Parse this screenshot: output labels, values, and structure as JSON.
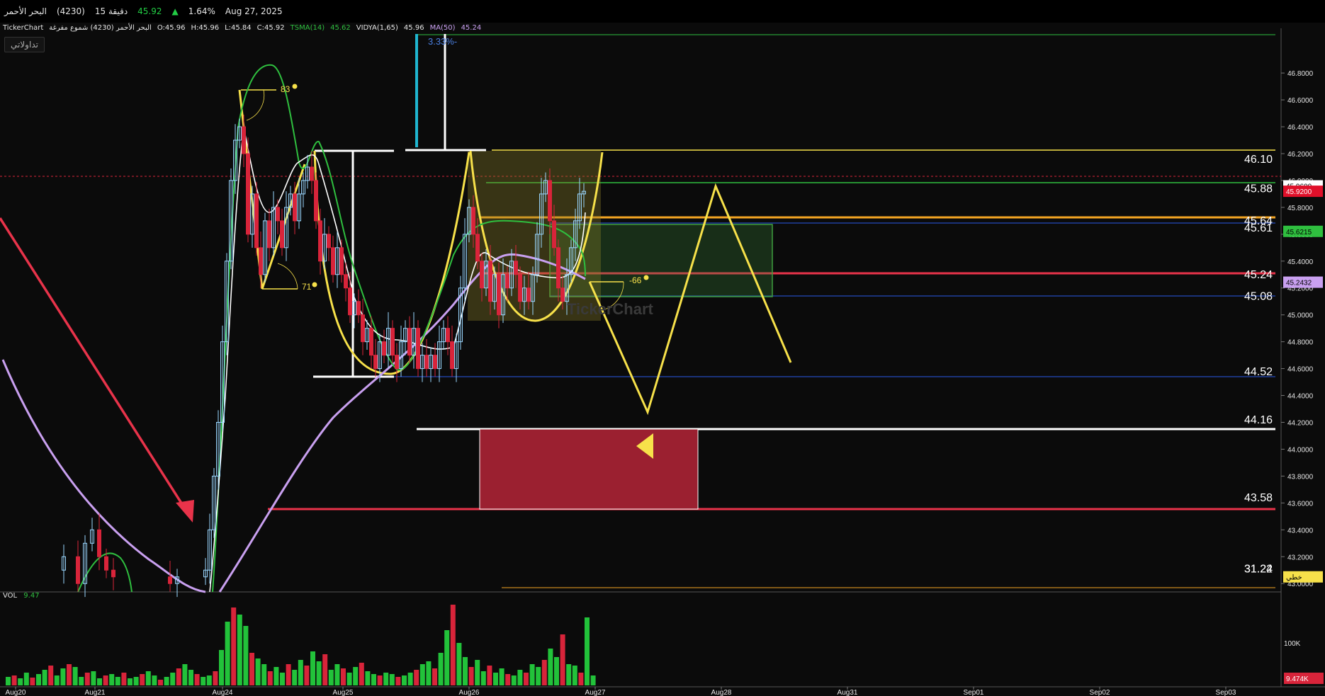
{
  "topbar": {
    "symbol": "البحر الأحمر",
    "code": "(4230)",
    "interval": "15 دقيقة",
    "last": "45.92",
    "change_pct": "1.64%",
    "date": "Aug 27, 2025"
  },
  "infobar": {
    "source": "TickerChart",
    "name": "البحر الأحمر (4230) شموع مفرغة",
    "open": "O:45.96",
    "high": "H:45.96",
    "low": "L:45.84",
    "close": "C:45.92",
    "tsma_label": "TSMA(14)",
    "tsma_value": "45.62",
    "vidya_label": "VIDYA(1,65)",
    "vidya_value": "45.96",
    "ma_label": "MA(50)",
    "ma_value": "45.24"
  },
  "logo_text": "تداولاتي",
  "watermark": "TickerChart",
  "volume": {
    "label": "VOL",
    "value": "9.47",
    "axis_label": "100K",
    "last_badge": "9.474K"
  },
  "colors": {
    "background": "#0b0b0b",
    "up": "#22c23a",
    "down": "#d8243a",
    "yellow": "#f7e14a",
    "orange": "#f5a623",
    "red_line": "#e8334a",
    "purple": "#c9a0f0",
    "tsma": "#2fbf3f",
    "vidya": "#ffffff",
    "navy": "#1f3fa0"
  },
  "chart_data": {
    "type": "candlestick",
    "price_axis": {
      "ticks": [
        "46.8000",
        "46.6000",
        "46.4000",
        "46.2000",
        "46.0000",
        "45.8000",
        "45.6000",
        "45.4000",
        "45.2000",
        "45.0000",
        "44.8000",
        "44.6000",
        "44.4000",
        "44.2000",
        "44.0000",
        "43.8000",
        "43.6000",
        "43.4000",
        "43.2000",
        "43.0000"
      ],
      "ylim": [
        42.98,
        47.08
      ]
    },
    "x_ticks": [
      "Aug20",
      "Aug21",
      "Aug24",
      "Aug25",
      "Aug26",
      "Aug27",
      "Aug28",
      "Aug31",
      "Sep01",
      "Sep02",
      "Sep03"
    ],
    "last_price": "45.9200",
    "price_badges": [
      {
        "text": "45.9600",
        "value": 45.96,
        "bg": "#ffffff",
        "fg": "#000000"
      },
      {
        "text": "45.9200",
        "value": 45.92,
        "bg": "#e0102a",
        "fg": "#ffffff"
      },
      {
        "text": "45.6215",
        "value": 45.6215,
        "bg": "#2fbf3f",
        "fg": "#000000"
      },
      {
        "text": "45.2432",
        "value": 45.2432,
        "bg": "#c9a0f0",
        "fg": "#000000"
      },
      {
        "text": "خطي",
        "value": 43.05,
        "bg": "#f7e14a",
        "fg": "#000000"
      }
    ],
    "level_labels": [
      {
        "text": "46.10",
        "value": 46.1
      },
      {
        "text": "45.88",
        "value": 45.88
      },
      {
        "text": "45.64",
        "value": 45.64
      },
      {
        "text": "45.61",
        "value": 45.61
      },
      {
        "text": "45.24",
        "value": 45.24
      },
      {
        "text": "45.08",
        "value": 45.08
      },
      {
        "text": "44.52",
        "value": 44.52
      },
      {
        "text": "44.16",
        "value": 44.16
      },
      {
        "text": "43.58",
        "value": 43.58
      },
      {
        "text": "31.24",
        "value": 43.05
      },
      {
        "text": "31.22",
        "value": 43.05
      }
    ],
    "annotations": [
      {
        "text": "83",
        "kind": "angle"
      },
      {
        "text": "71",
        "kind": "angle"
      },
      {
        "text": "-66",
        "kind": "angle"
      },
      {
        "text": "3.33%-",
        "kind": "percent"
      }
    ]
  }
}
